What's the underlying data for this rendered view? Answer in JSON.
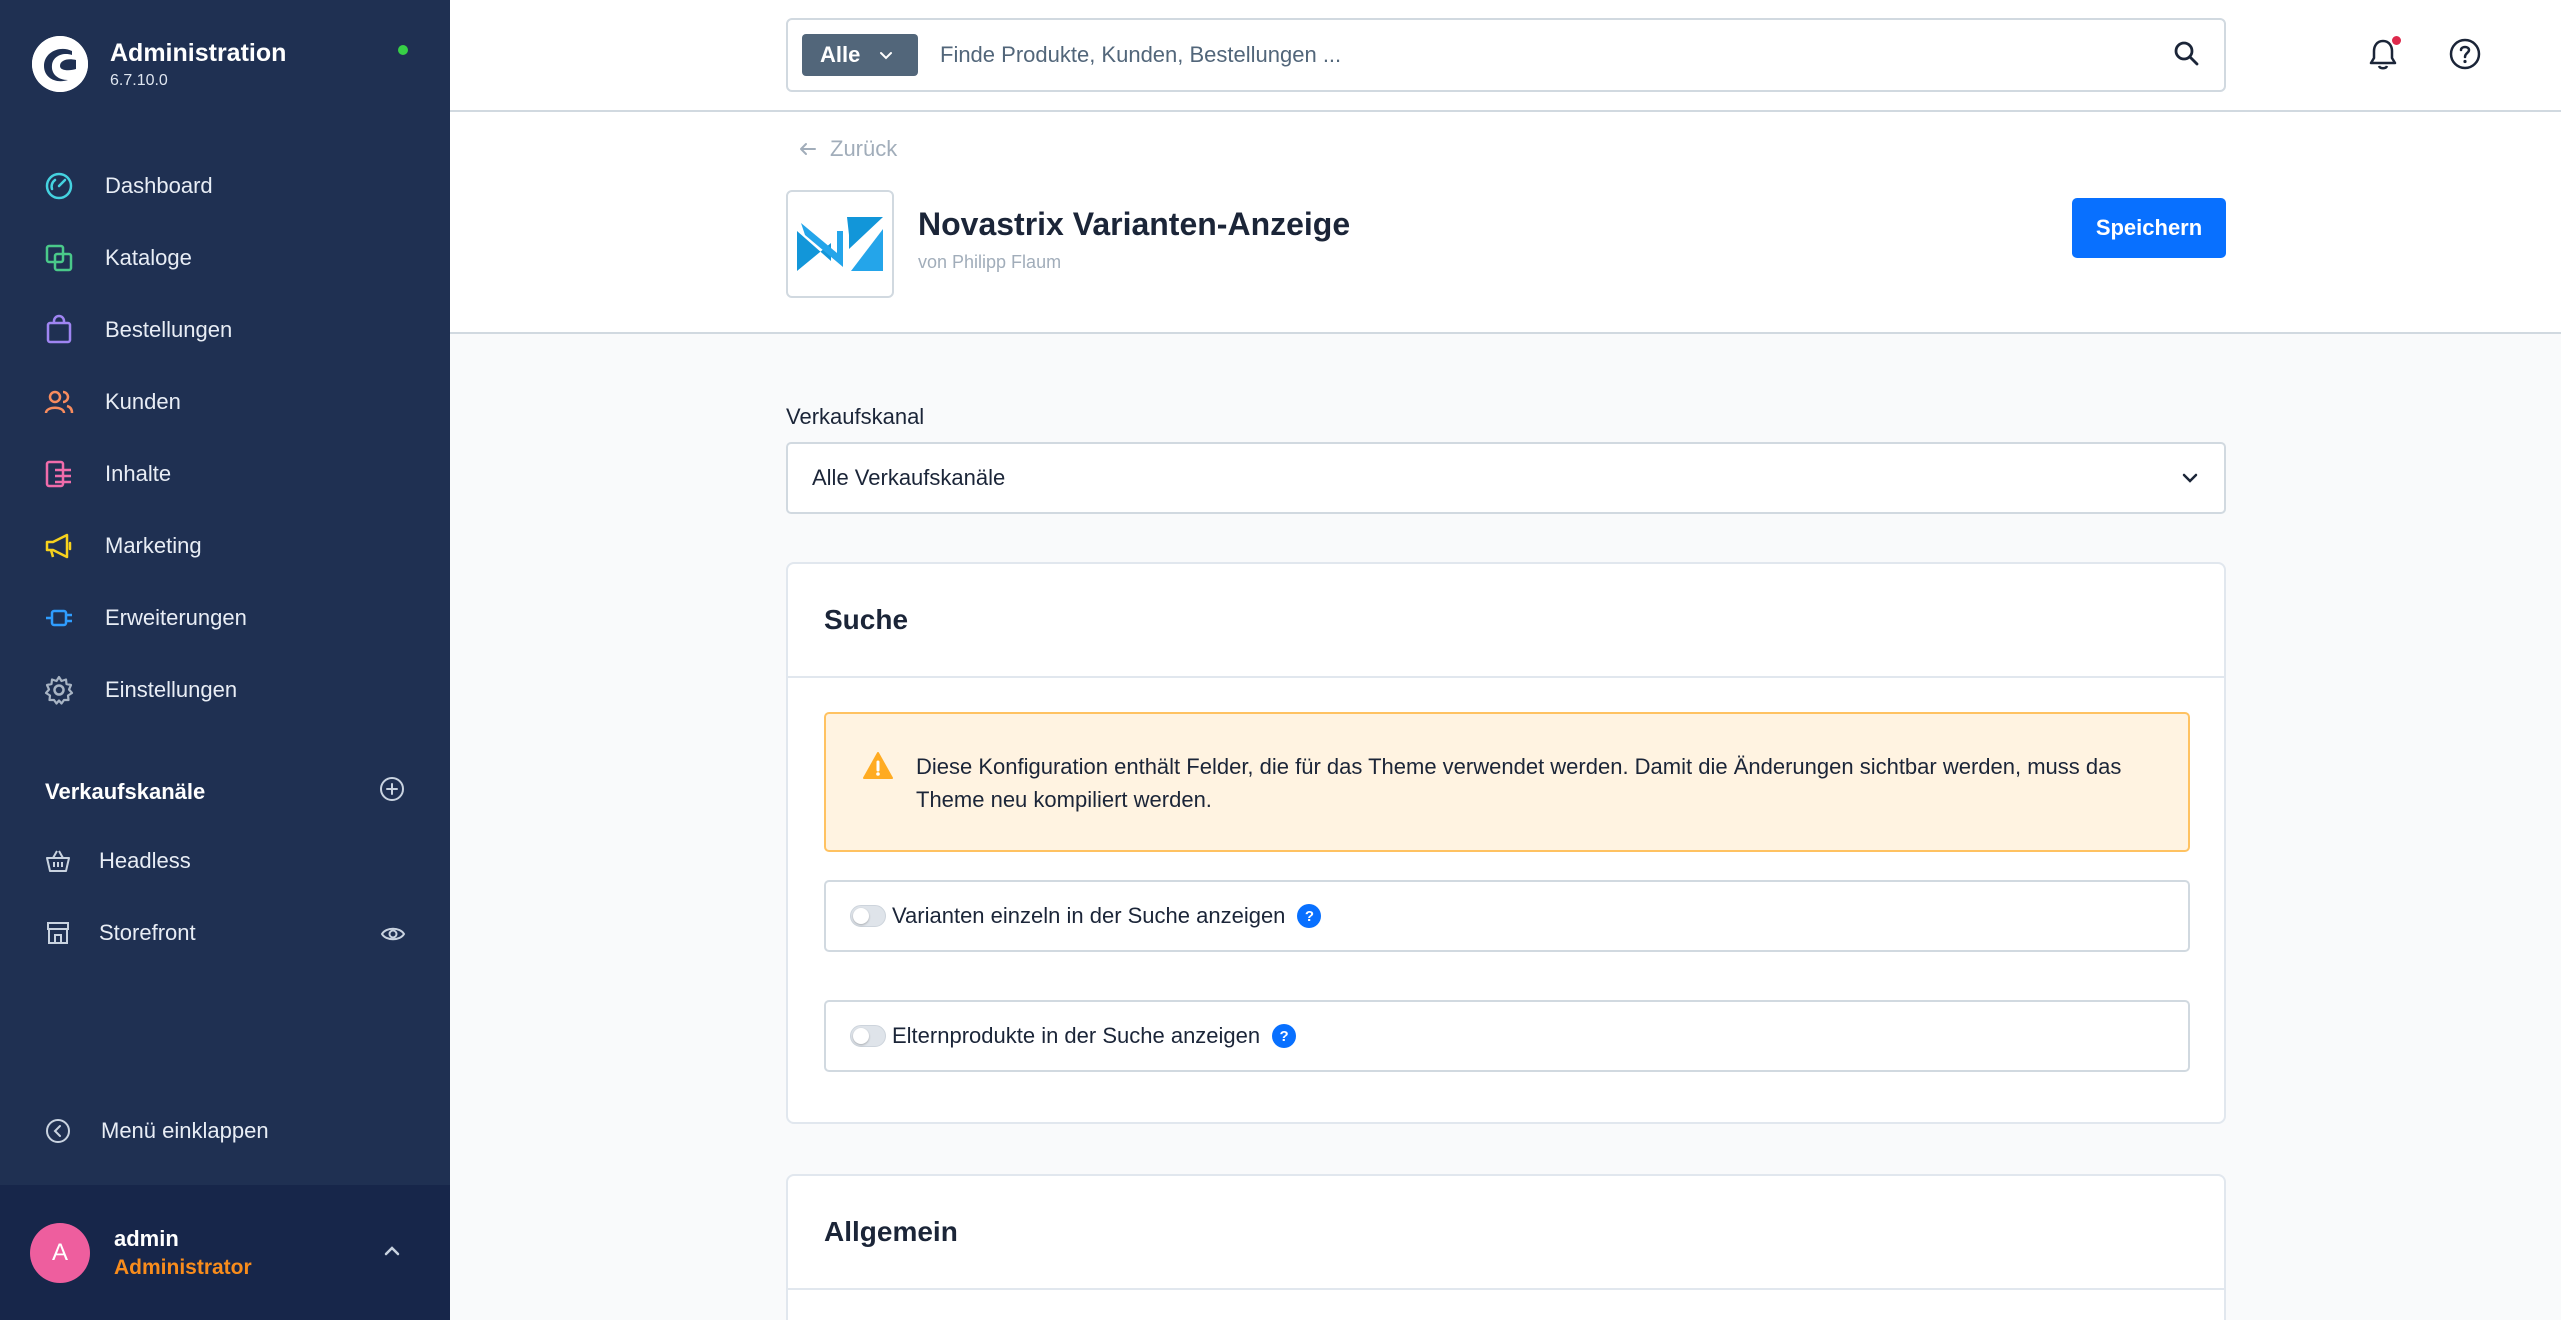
{
  "app": {
    "title": "Administration",
    "version": "6.7.10.0",
    "status_color": "#37d046"
  },
  "sidebar": {
    "nav": [
      {
        "label": "Dashboard",
        "icon": "dashboard-icon",
        "color": "#45d2e0"
      },
      {
        "label": "Kataloge",
        "icon": "catalog-icon",
        "color": "#4ac98a"
      },
      {
        "label": "Bestellungen",
        "icon": "shopping-bag-icon",
        "color": "#9f85f2"
      },
      {
        "label": "Kunden",
        "icon": "customers-icon",
        "color": "#f88c5e"
      },
      {
        "label": "Inhalte",
        "icon": "content-icon",
        "color": "#f06cab"
      },
      {
        "label": "Marketing",
        "icon": "megaphone-icon",
        "color": "#f7d21d"
      },
      {
        "label": "Erweiterungen",
        "icon": "plug-icon",
        "color": "#2f9dff"
      },
      {
        "label": "Einstellungen",
        "icon": "gear-icon",
        "color": "#a8b4c4"
      }
    ],
    "sales_channels": {
      "title": "Verkaufskanäle",
      "items": [
        {
          "label": "Headless",
          "icon": "basket-icon"
        },
        {
          "label": "Storefront",
          "icon": "storefront-icon"
        }
      ]
    },
    "collapse_label": "Menü einklappen",
    "user": {
      "initial": "A",
      "name": "admin",
      "role": "Administrator",
      "avatar_color": "#ee5e9e",
      "role_color": "#f88c1c"
    }
  },
  "topbar": {
    "search_type": "Alle",
    "search_placeholder": "Finde Produkte, Kunden, Bestellungen ...",
    "notification_dot_color": "#de294c"
  },
  "header": {
    "back_label": "Zurück",
    "plugin_title": "Novastrix Varianten-Anzeige",
    "plugin_author": "von Philipp Flaum",
    "save_label": "Speichern",
    "accent_color": "#0870ff"
  },
  "content": {
    "sales_channel_label": "Verkaufskanal",
    "sales_channel_value": "Alle Verkaufskanäle",
    "cards": [
      {
        "title": "Suche",
        "alert": "Diese Konfiguration enthält Felder, die für das Theme verwendet werden. Damit die Änderungen sichtbar werden, muss das Theme neu kompiliert werden.",
        "toggles": [
          {
            "label": "Varianten einzeln in der Suche anzeigen",
            "enabled": false,
            "help": "?"
          },
          {
            "label": "Elternprodukte in der Suche anzeigen",
            "enabled": false,
            "help": "?"
          }
        ]
      },
      {
        "title": "Allgemein"
      }
    ]
  }
}
